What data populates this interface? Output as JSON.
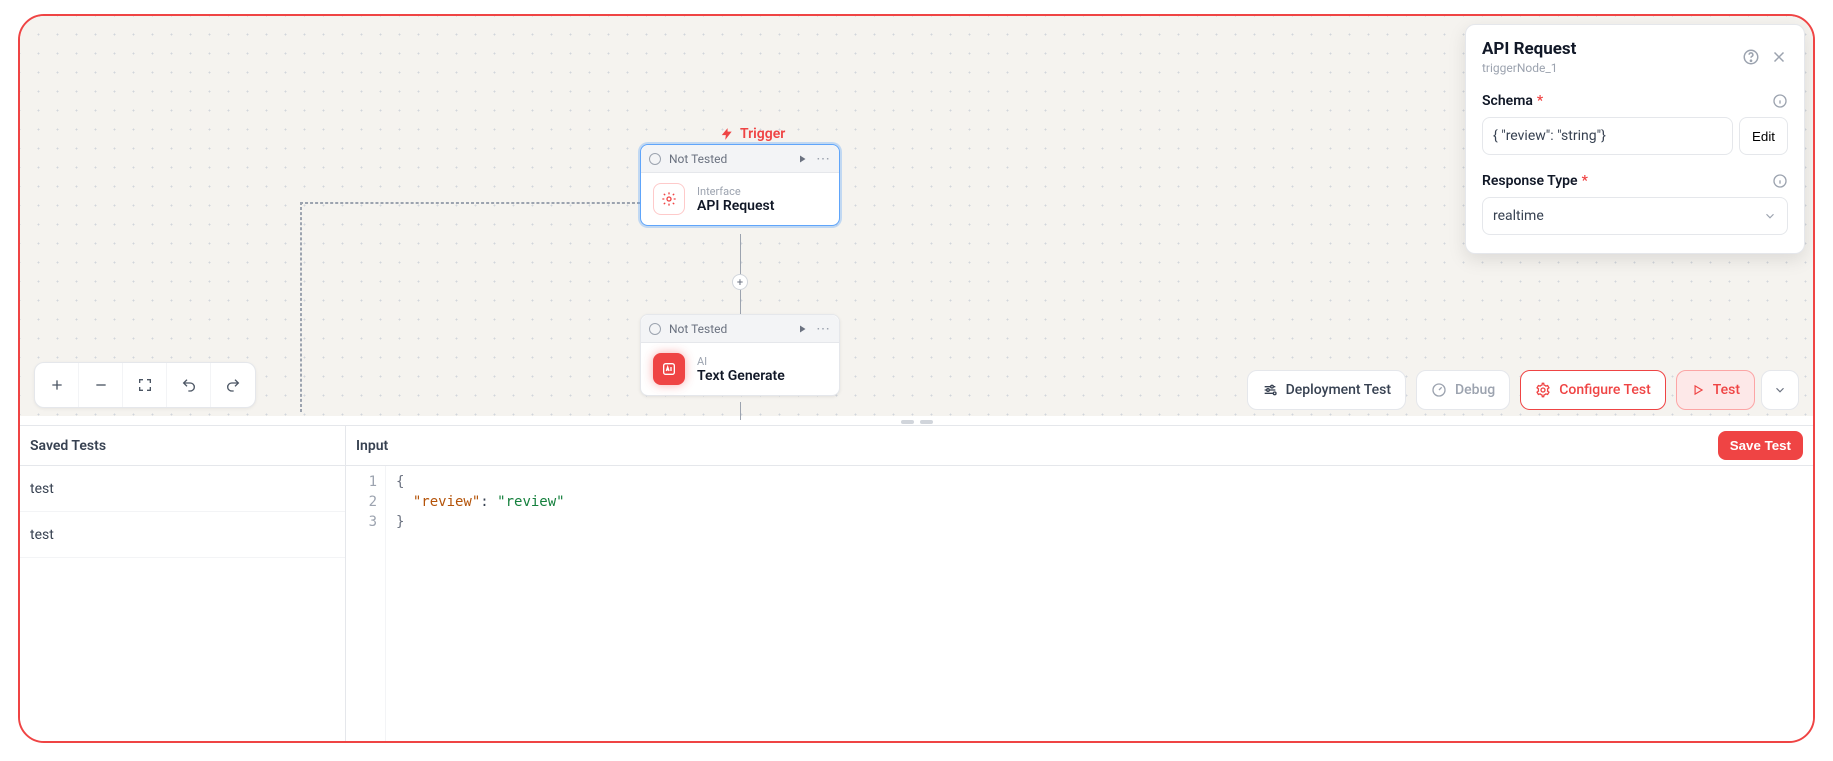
{
  "canvas": {
    "trigger_label": "Trigger",
    "node1": {
      "status": "Not Tested",
      "category": "Interface",
      "title": "API Request"
    },
    "node2": {
      "status": "Not Tested",
      "category": "AI",
      "title": "Text Generate"
    }
  },
  "toolbar": {
    "deployment_test": "Deployment Test",
    "debug": "Debug",
    "configure_test": "Configure Test",
    "test": "Test"
  },
  "bottom": {
    "saved_tests_title": "Saved Tests",
    "tests": [
      "test",
      "test"
    ],
    "input_title": "Input",
    "save_btn": "Save Test",
    "editor_lines": [
      "{",
      "  \"review\": \"review\"",
      "}"
    ]
  },
  "side_panel": {
    "title": "API Request",
    "subtitle": "triggerNode_1",
    "schema_label": "Schema",
    "schema_value": "{ \"review\": \"string\"}",
    "edit_btn": "Edit",
    "response_type_label": "Response Type",
    "response_type_value": "realtime"
  }
}
